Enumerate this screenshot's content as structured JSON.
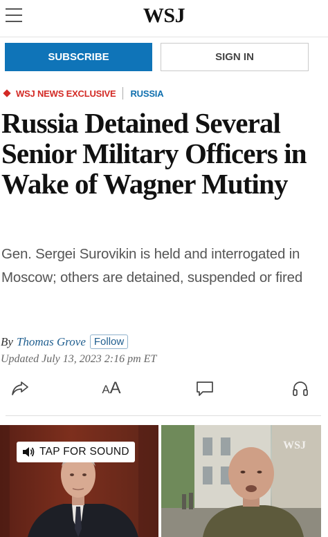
{
  "header": {
    "logo_text": "WSJ",
    "menu_icon": "hamburger-menu-icon"
  },
  "auth": {
    "subscribe_label": "SUBSCRIBE",
    "signin_label": "SIGN IN",
    "subscribe_color": "#0f74b8"
  },
  "article": {
    "kicker_exclusive": "WSJ NEWS EXCLUSIVE",
    "kicker_section": "RUSSIA",
    "kicker_color": "#d32a25",
    "section_color": "#0f6fae",
    "headline": "Russia Detained Several Senior Military Officers in Wake of Wagner Mutiny",
    "dek": "Gen. Sergei Surovikin is held and interrogated in Moscow; others are detained, suspended or fired",
    "byline_prefix": "By",
    "author": "Thomas Grove",
    "follow_label": "Follow",
    "updated": "Updated July 13, 2023 2:16 pm ET"
  },
  "actions": {
    "share_icon": "share-icon",
    "font_size_icon": "font-size-icon",
    "font_size_label_small": "A",
    "font_size_label_big": "A",
    "comment_icon": "comment-icon",
    "listen_icon": "headphones-icon"
  },
  "video": {
    "tap_for_sound_label": "TAP FOR SOUND",
    "watermark": "WSJ"
  }
}
